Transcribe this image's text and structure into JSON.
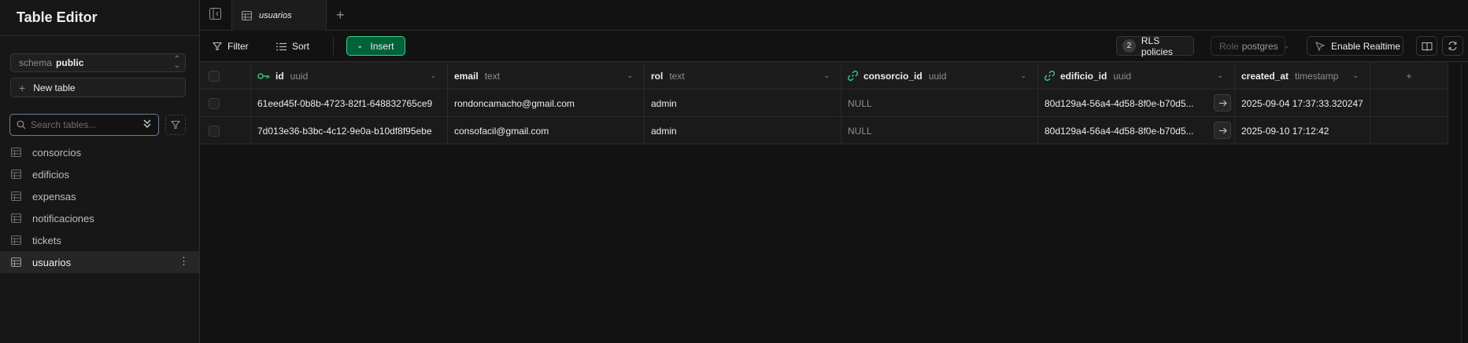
{
  "sidebar": {
    "title": "Table Editor",
    "schema": {
      "label": "schema",
      "value": "public"
    },
    "new_table_label": "New table",
    "search": {
      "placeholder": "Search tables...",
      "value": ""
    },
    "tables": [
      {
        "name": "consorcios",
        "active": false
      },
      {
        "name": "edificios",
        "active": false
      },
      {
        "name": "expensas",
        "active": false
      },
      {
        "name": "notificaciones",
        "active": false
      },
      {
        "name": "tickets",
        "active": false
      },
      {
        "name": "usuarios",
        "active": true
      }
    ]
  },
  "tabs": [
    {
      "label": "usuarios",
      "active": true
    }
  ],
  "toolbar": {
    "filter_label": "Filter",
    "sort_label": "Sort",
    "insert_label": "Insert",
    "rls_count": "2",
    "rls_label": "RLS policies",
    "role_label": "Role",
    "role_value": "postgres",
    "realtime_label": "Enable Realtime"
  },
  "columns": [
    {
      "name": "id",
      "type": "uuid",
      "icon": "key-icon"
    },
    {
      "name": "email",
      "type": "text",
      "icon": ""
    },
    {
      "name": "rol",
      "type": "text",
      "icon": ""
    },
    {
      "name": "consorcio_id",
      "type": "uuid",
      "icon": "link-icon"
    },
    {
      "name": "edificio_id",
      "type": "uuid",
      "icon": "link-icon"
    },
    {
      "name": "created_at",
      "type": "timestamp",
      "icon": ""
    }
  ],
  "rows": [
    {
      "id": "61eed45f-0b8b-4723-82f1-648832765ce9",
      "email": "rondoncamacho@gmail.com",
      "rol": "admin",
      "consorcio_id": "NULL",
      "edificio_id": "80d129a4-56a4-4d58-8f0e-b70d5...",
      "created_at": "2025-09-04 17:37:33.320247"
    },
    {
      "id": "7d013e36-b3bc-4c12-9e0a-b10df8f95ebe",
      "email": "consofacil@gmail.com",
      "rol": "admin",
      "consorcio_id": "NULL",
      "edificio_id": "80d129a4-56a4-4d58-8f0e-b70d5...",
      "created_at": "2025-09-10 17:12:42"
    }
  ],
  "colors": {
    "accent_green": "#3ecf8e",
    "insert_bg": "#006239",
    "background": "#121212",
    "sidebar_bg": "#171717"
  }
}
